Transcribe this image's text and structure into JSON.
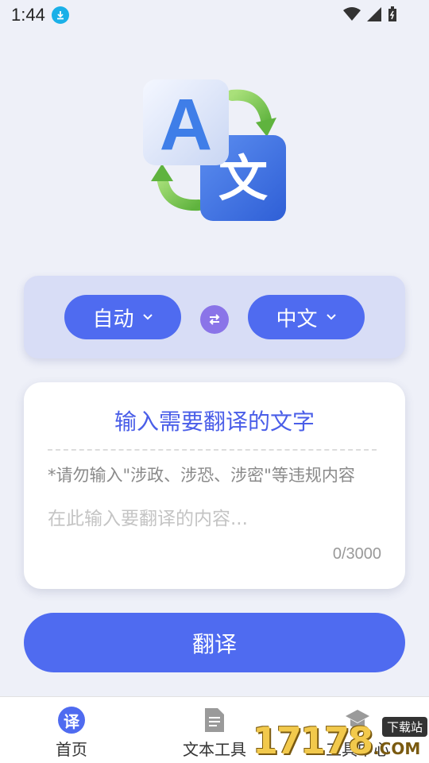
{
  "status_bar": {
    "time": "1:44"
  },
  "language_selector": {
    "source_language": "自动",
    "target_language": "中文"
  },
  "input_card": {
    "title": "输入需要翻译的文字",
    "warning": "*请勿输入\"涉政、涉恐、涉密\"等违规内容",
    "placeholder": "在此输入要翻译的内容...",
    "counter": "0/3000"
  },
  "translate_button": {
    "label": "翻译"
  },
  "bottom_nav": {
    "items": [
      {
        "label": "首页",
        "icon": "translate-icon",
        "icon_text": "译",
        "active": true
      },
      {
        "label": "文本工具",
        "icon": "document-icon"
      },
      {
        "label": "工具中心",
        "icon": "graduation-cap-icon"
      }
    ]
  },
  "watermark": {
    "number": "17178",
    "suffix": ".COM",
    "tag": "下载站"
  },
  "colors": {
    "accent": "#4f6bf0",
    "background": "#eef0f8",
    "title_blue": "#4a5ee8",
    "swap_purple": "#8a74e8",
    "selector_bg": "#d8ddf6"
  }
}
